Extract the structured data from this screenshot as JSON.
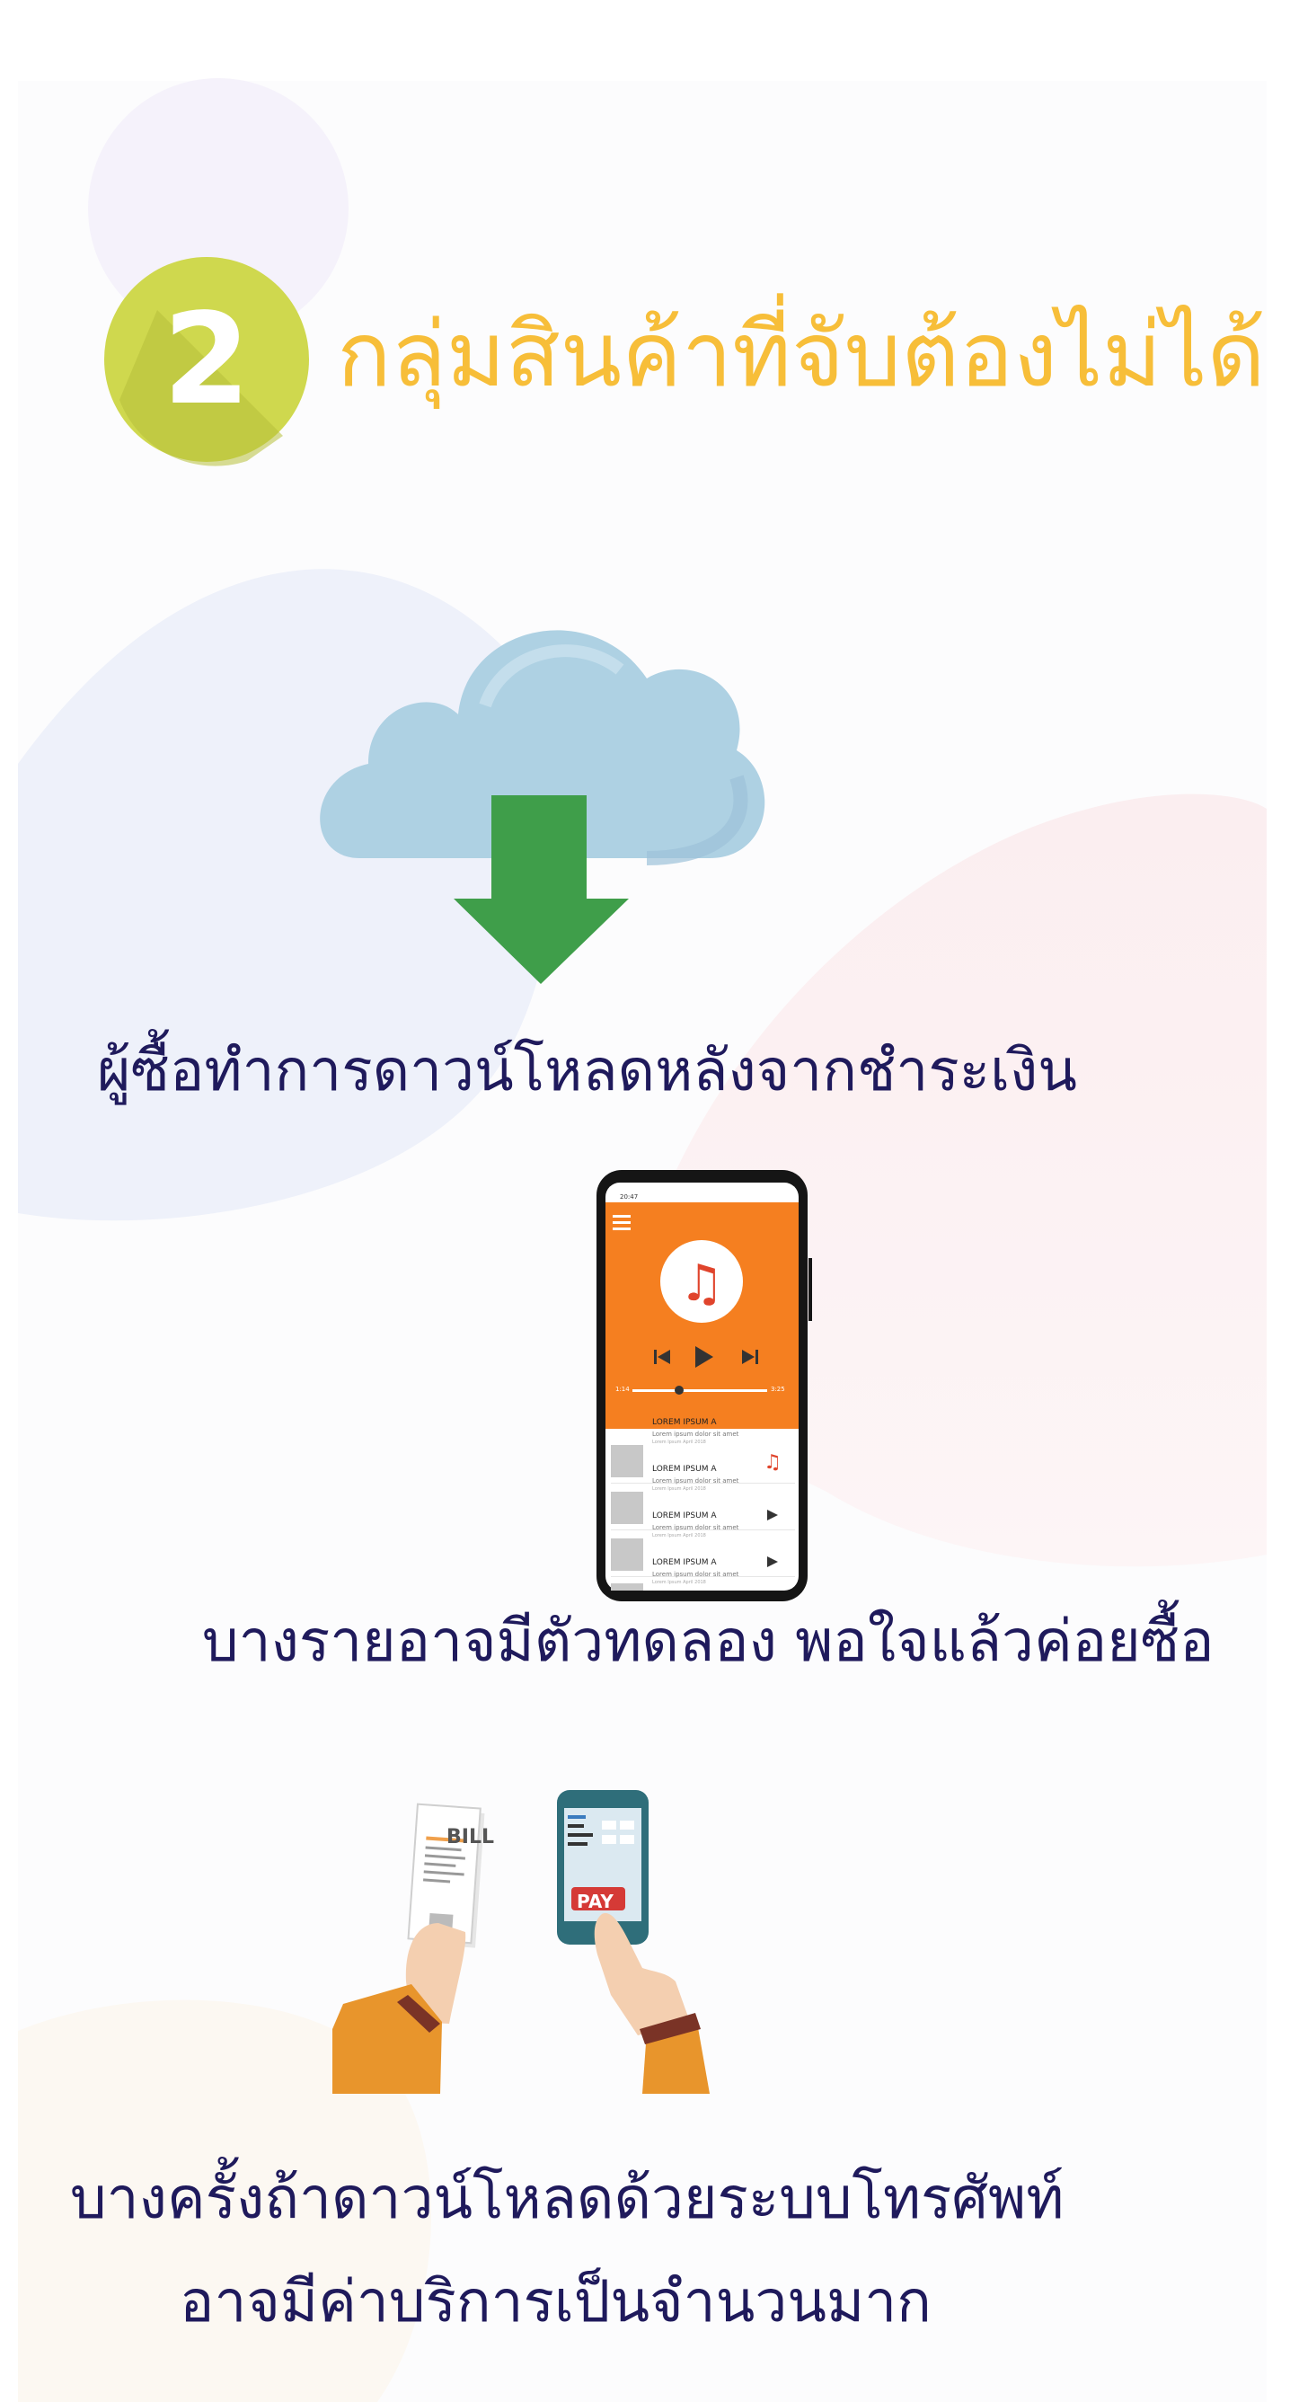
{
  "header": {
    "step_number": "2",
    "title": "กลุ่มสินค้าที่จับต้องไม่ได้"
  },
  "sections": [
    {
      "caption": "ผู้ซื้อทำการดาวน์โหลดหลังจากชำระเงิน",
      "icon": "cloud-download-icon"
    },
    {
      "caption": "บางรายอาจมีตัวทดลอง พอใจแล้วค่อยซื้อ",
      "icon": "music-player-phone-icon"
    },
    {
      "caption_lines": [
        "บางครั้งถ้าดาวน์โหลดด้วยระบบโทรศัพท์",
        "อาจมีค่าบริการเป็นจำนวนมาก"
      ],
      "icon": "mobile-payment-icon"
    }
  ],
  "phone_player": {
    "status_time": "20:47",
    "time_elapsed": "1:14",
    "time_total": "3:25",
    "tracks": [
      {
        "title": "LOREM IPSUM A",
        "subtitle": "Lorem ipsum dolor sit amet",
        "meta": "Lorem Ipsum April 2018"
      },
      {
        "title": "LOREM IPSUM A",
        "subtitle": "Lorem ipsum dolor sit amet",
        "meta": "Lorem Ipsum April 2018"
      },
      {
        "title": "LOREM IPSUM A",
        "subtitle": "Lorem ipsum dolor sit amet",
        "meta": "Lorem Ipsum April 2018"
      },
      {
        "title": "LOREM IPSUM A",
        "subtitle": "Lorem ipsum dolor sit amet",
        "meta": "Lorem Ipsum April 2018"
      }
    ]
  },
  "payment": {
    "bill_label": "BILL",
    "pay_label": "PAY"
  },
  "colors": {
    "title": "#f7be39",
    "text": "#1f1a5c",
    "badge": "#cfd84e",
    "cloud": "#aed1e3",
    "arrow": "#3f9e4a",
    "player_orange": "#f57f20"
  }
}
